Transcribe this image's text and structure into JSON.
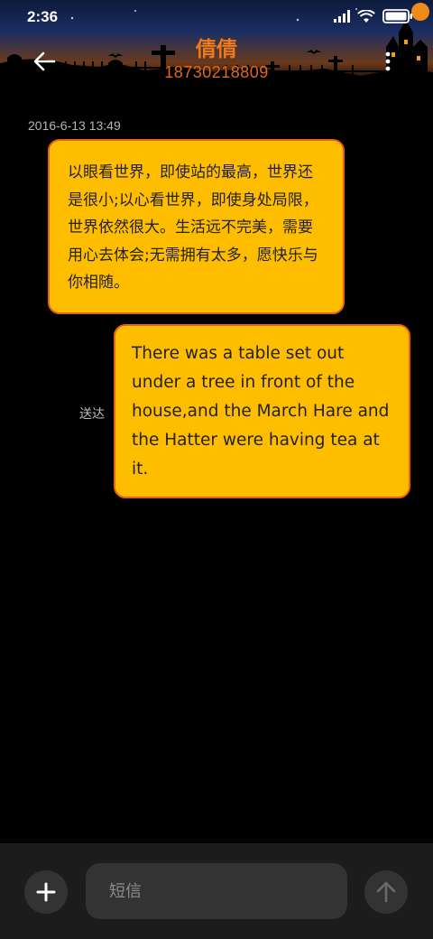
{
  "status_bar": {
    "time": "2:36",
    "icons": [
      "signal-icon",
      "wifi-icon",
      "battery-icon"
    ]
  },
  "conversation": {
    "contact_name": "倩倩",
    "contact_number": "18730218809",
    "back_icon": "back-arrow-icon",
    "more_icon": "more-vertical-icon"
  },
  "messages": {
    "timestamp": "2016-6-13 13:49",
    "incoming": {
      "text": "以眼看世界，即使站的最高，世界还是很小;以心看世界，即使身处局限，世界依然很大。生活远不完美，需要用心去体会;无需拥有太多，愿快乐与你相随。"
    },
    "outgoing": {
      "text": "There was a table set out under a tree in front of the house,and the March Hare and the Hatter were having tea at it.",
      "status": "送达"
    }
  },
  "composer": {
    "placeholder": "短信",
    "add_icon": "plus-icon",
    "send_icon": "send-arrow-up-icon"
  },
  "theme": {
    "bubble_fill": "#ffbd00",
    "bubble_border": "#e8611a",
    "title_color": "#f07a1a",
    "background": "#000000"
  }
}
